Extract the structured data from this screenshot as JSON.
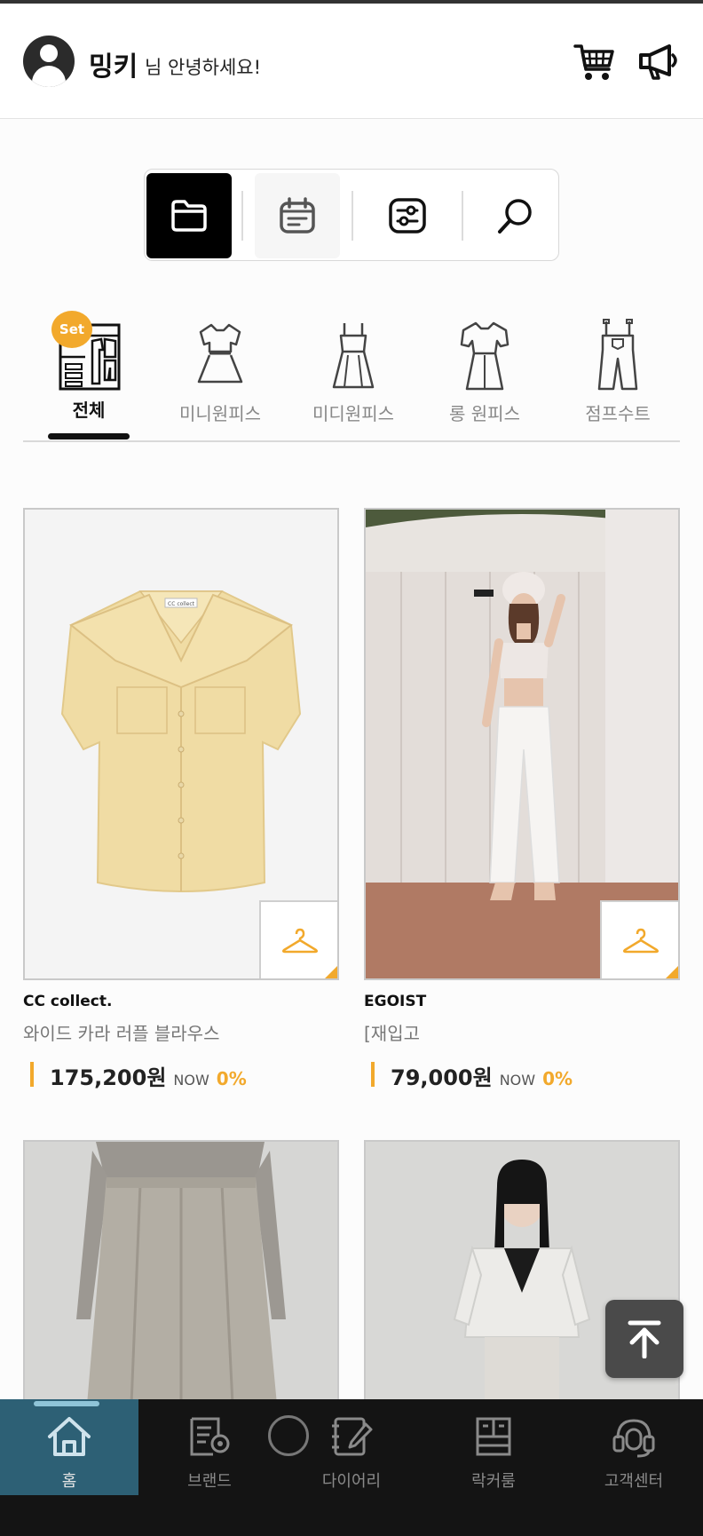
{
  "header": {
    "user_name": "밍키",
    "greeting": "님 안녕하세요!",
    "cart_icon": "cart-icon",
    "notice_icon": "megaphone-icon"
  },
  "toolbar": {
    "items": [
      {
        "icon": "folder-icon",
        "active": true
      },
      {
        "icon": "calendar-icon",
        "active": false
      },
      {
        "icon": "filter-settings-icon",
        "active": false
      },
      {
        "icon": "search-icon",
        "active": false
      }
    ]
  },
  "categories": {
    "badge": "Set",
    "items": [
      {
        "label": "전체",
        "icon": "closet-icon",
        "active": true
      },
      {
        "label": "미니원피스",
        "icon": "mini-dress-icon",
        "active": false
      },
      {
        "label": "미디원피스",
        "icon": "midi-dress-icon",
        "active": false
      },
      {
        "label": "롱 원피스",
        "icon": "long-dress-icon",
        "active": false
      },
      {
        "label": "점프수트",
        "icon": "jumpsuit-icon",
        "active": false
      }
    ]
  },
  "products": [
    {
      "brand": "CC collect.",
      "name": "와이드 카라 러플 블라우스",
      "price": "175,200원",
      "now": "NOW",
      "discount": "0%",
      "label_tag": "CC collect"
    },
    {
      "brand": "EGOIST",
      "name": "[재입고",
      "price": "79,000원",
      "now": "NOW",
      "discount": "0%"
    },
    {
      "brand": "",
      "name": "",
      "price": "",
      "now": "",
      "discount": ""
    },
    {
      "brand": "",
      "name": "",
      "price": "",
      "now": "",
      "discount": ""
    }
  ],
  "bottom_nav": {
    "items": [
      {
        "label": "홈",
        "icon": "home-icon",
        "active": true
      },
      {
        "label": "브랜드",
        "icon": "brand-book-icon",
        "active": false
      },
      {
        "label": "다이어리",
        "icon": "diary-icon",
        "active": false
      },
      {
        "label": "락커룸",
        "icon": "locker-icon",
        "active": false
      },
      {
        "label": "고객센터",
        "icon": "headset-icon",
        "active": false
      }
    ]
  },
  "colors": {
    "accent": "#f2a92c",
    "nav_bg": "#141414",
    "nav_active": "#2d6075"
  }
}
